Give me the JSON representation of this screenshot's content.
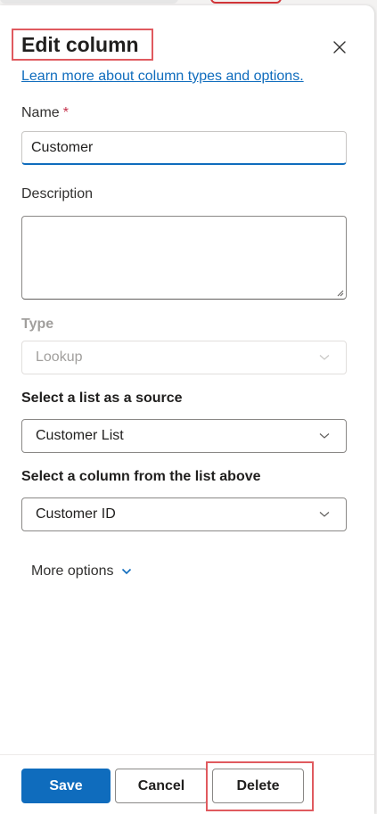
{
  "panel": {
    "title": "Edit column",
    "close_icon": "close-icon",
    "learn_more_link": "Learn more about column types and options."
  },
  "fields": {
    "name": {
      "label": "Name",
      "required_marker": "*",
      "value": "Customer"
    },
    "description": {
      "label": "Description",
      "value": ""
    },
    "type": {
      "label": "Type",
      "value": "Lookup",
      "disabled": true
    },
    "source_list": {
      "label": "Select a list as a source",
      "value": "Customer List"
    },
    "source_column": {
      "label": "Select a column from the list above",
      "value": "Customer ID"
    }
  },
  "more_options": {
    "label": "More options",
    "icon": "chevron-down-icon"
  },
  "footer": {
    "save_label": "Save",
    "cancel_label": "Cancel",
    "delete_label": "Delete"
  },
  "colors": {
    "accent": "#0f6cbd",
    "highlight": "#e05a5f",
    "required": "#c4314b",
    "disabled_text": "#a19f9d"
  }
}
